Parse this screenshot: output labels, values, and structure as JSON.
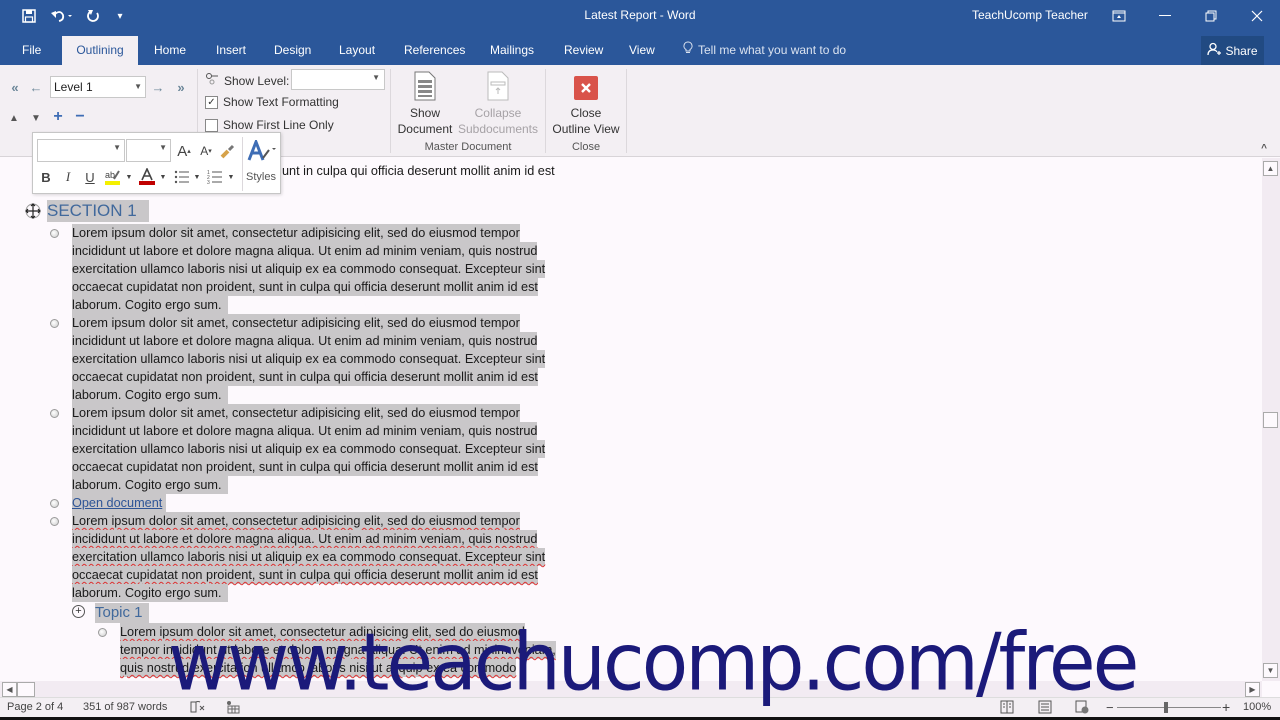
{
  "window": {
    "title": "Latest Report - Word",
    "user": "TeachUcomp Teacher",
    "quick_access": [
      "save-icon",
      "undo-icon",
      "redo-icon",
      "customize-icon"
    ],
    "controls": [
      "ribbon-display-icon",
      "minimize-icon",
      "restore-icon",
      "close-icon"
    ]
  },
  "tabs": [
    {
      "label": "File",
      "active": false
    },
    {
      "label": "Outlining",
      "active": true
    },
    {
      "label": "Home",
      "active": false
    },
    {
      "label": "Insert",
      "active": false
    },
    {
      "label": "Design",
      "active": false
    },
    {
      "label": "Layout",
      "active": false
    },
    {
      "label": "References",
      "active": false
    },
    {
      "label": "Mailings",
      "active": false
    },
    {
      "label": "Review",
      "active": false
    },
    {
      "label": "View",
      "active": false
    }
  ],
  "tell_me": "Tell me what you want to do",
  "share": "Share",
  "ribbon": {
    "outline_tools": {
      "level_value": "Level 1",
      "show_level_label": "Show Level:",
      "show_level_value": "",
      "show_text_formatting": {
        "label": "Show Text Formatting",
        "checked": true
      },
      "show_first_line_only": {
        "label": "Show First Line Only",
        "checked": false
      }
    },
    "master_document": {
      "group_label": "Master Document",
      "show_document": "Show Document",
      "show_document_l1": "Show",
      "show_document_l2": "Document",
      "collapse_l1": "Collapse",
      "collapse_l2": "Subdocuments"
    },
    "close": {
      "group_label": "Close",
      "l1": "Close",
      "l2": "Outline View"
    }
  },
  "mini_toolbar": {
    "font_value": "",
    "size_value": "",
    "styles_label": "Styles",
    "bold": "B",
    "italic": "I",
    "underline": "U",
    "highlight_color": "#f4f000",
    "font_color": "#c00000"
  },
  "document": {
    "top_partial_line": "unt in culpa qui officia deserunt mollit anim id est",
    "section_heading": "SECTION 1",
    "paragraph_lines": [
      "Lorem ipsum dolor sit amet, consectetur adipisicing elit, sed do eiusmod tempor",
      "incididunt ut labore et dolore magna aliqua. Ut enim ad minim veniam, quis nostrud",
      "exercitation ullamco laboris nisi ut aliquip ex ea commodo consequat. Excepteur sint",
      "occaecat cupidatat non proident, sunt in culpa qui officia deserunt mollit anim id est",
      "laborum. Cogito ergo sum."
    ],
    "link_text": "Open document",
    "topic_heading": "Topic 1",
    "topic_lines": [
      "Lorem ipsum dolor sit amet, consectetur adipisicing elit, sed do eiusmod",
      "tempor incididunt ut labore et dolore magna aliqua. Ut enim ad minim veniam,",
      "quis nostrud exercitation ullamco laboris nisi ut aliquip ex ea commodo"
    ]
  },
  "watermark": "www.teachucomp.com/free",
  "status": {
    "page": "Page 2 of 4",
    "words": "351 of 987 words",
    "zoom": "100%",
    "zoom_percent": 100
  }
}
